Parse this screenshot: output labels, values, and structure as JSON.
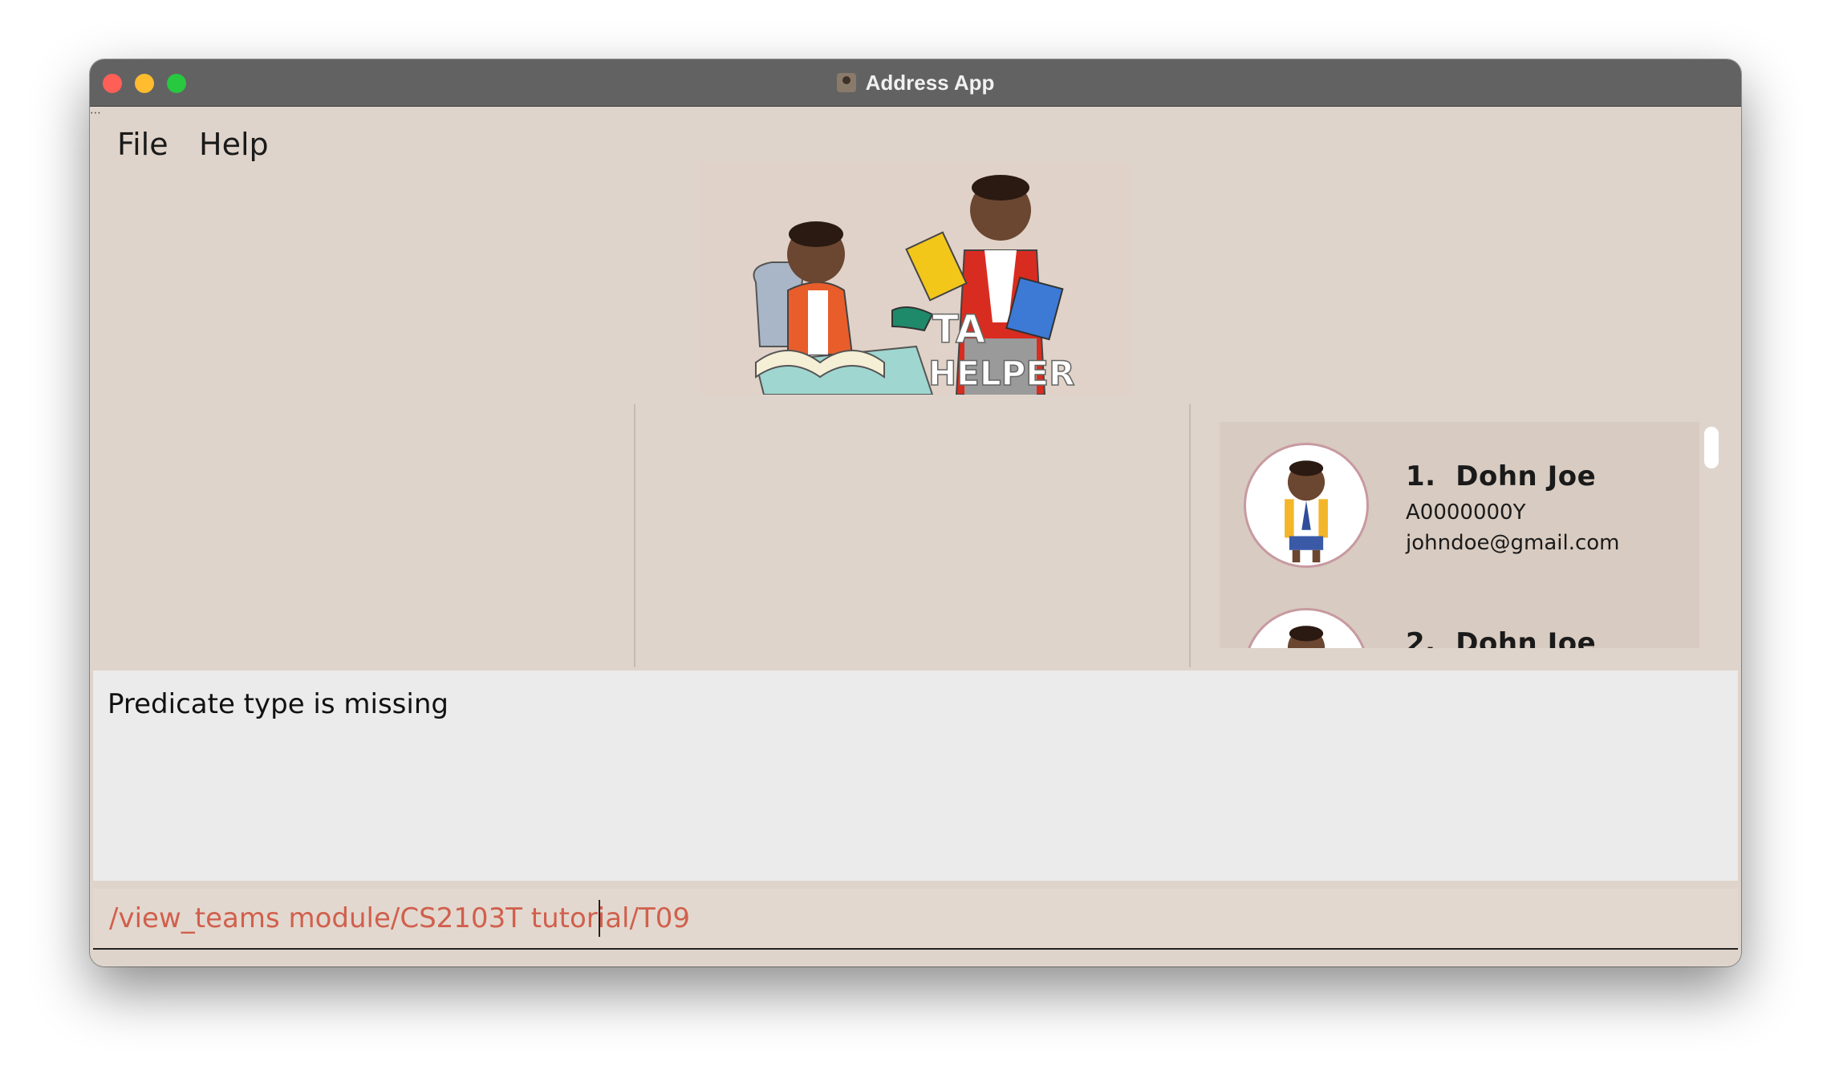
{
  "window": {
    "title": "Address App"
  },
  "menu": {
    "items": [
      "File",
      "Help"
    ]
  },
  "banner": {
    "logo_text_line1": "TA",
    "logo_text_line2": "HELPER"
  },
  "students": [
    {
      "index": "1.",
      "name": "Dohn Joe",
      "id": "A0000000Y",
      "email": "johndoe@gmail.com"
    },
    {
      "index": "2.",
      "name": "Dohn Joe"
    }
  ],
  "result": {
    "message": "Predicate type is missing"
  },
  "command": {
    "value": "/view_teams module/CS2103T tutorial/T09"
  },
  "colors": {
    "window_bg": "#dfd4cb",
    "titlebar": "#626262",
    "command_text": "#d0604d",
    "result_bg": "#ebebeb",
    "list_bg": "#d8cbc1"
  }
}
